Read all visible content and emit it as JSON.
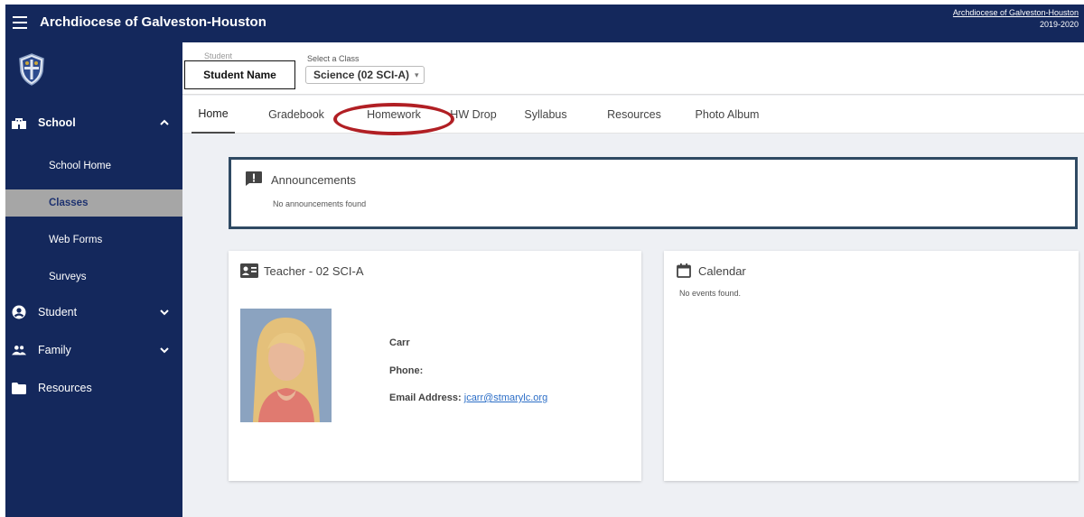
{
  "topbar": {
    "title": "Archdiocese of Galveston-Houston",
    "org_link": "Archdiocese of Galveston-Houston",
    "year": "2019-2020"
  },
  "sidebar": {
    "school": {
      "label": "School",
      "icon": "school-building-icon",
      "expanded": true
    },
    "sub_items": [
      {
        "label": "School Home",
        "active": false
      },
      {
        "label": "Classes",
        "active": true
      },
      {
        "label": "Web Forms",
        "active": false
      },
      {
        "label": "Surveys",
        "active": false
      }
    ],
    "student": {
      "label": "Student",
      "icon": "person-circle-icon"
    },
    "family": {
      "label": "Family",
      "icon": "people-icon"
    },
    "resources": {
      "label": "Resources",
      "icon": "folder-icon"
    }
  },
  "classbar": {
    "student_hint": "Student",
    "student_name": "Student Name",
    "class_label": "Select a Class",
    "class_value": "Science (02 SCI-A)"
  },
  "tabs": [
    {
      "label": "Home",
      "active": true
    },
    {
      "label": "Gradebook",
      "active": false
    },
    {
      "label": "Homework",
      "active": false,
      "highlighted": true
    },
    {
      "label": "HW Drop",
      "active": false
    },
    {
      "label": "Syllabus",
      "active": false
    },
    {
      "label": "Resources",
      "active": false
    },
    {
      "label": "Photo Album",
      "active": false
    }
  ],
  "announcements": {
    "title": "Announcements",
    "empty": "No announcements found"
  },
  "teacher": {
    "title": "Teacher - 02 SCI-A",
    "name": "Carr",
    "phone_label": "Phone:",
    "email_label": "Email Address:",
    "email": "jcarr@stmarylc.org"
  },
  "calendar": {
    "title": "Calendar",
    "empty": "No events found."
  },
  "colors": {
    "navy": "#14285c",
    "active_item_bg": "#a6a6a6",
    "highlight": "#b11f24",
    "link": "#2c6ec7"
  }
}
